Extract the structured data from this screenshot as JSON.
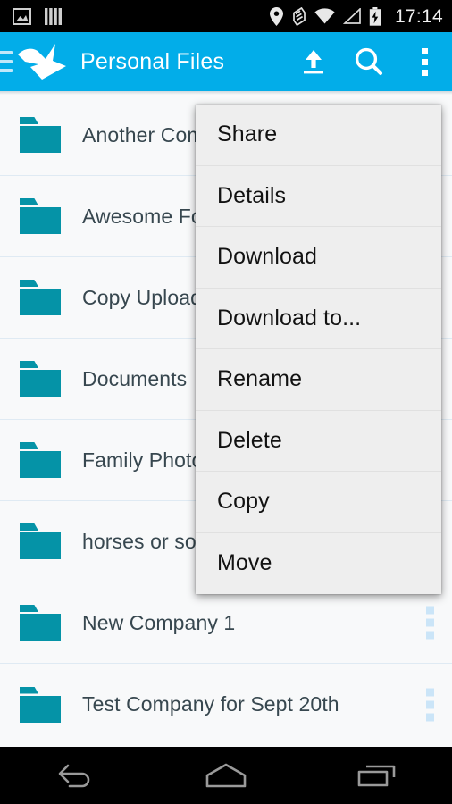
{
  "status_bar": {
    "left_icons": [
      "image-icon",
      "bars-icon"
    ],
    "right_icons": [
      "location-icon",
      "nfc-icon",
      "wifi-icon",
      "signal-icon",
      "battery-charging-icon"
    ],
    "clock": "17:14"
  },
  "app_bar": {
    "menu_icon": "hamburger-icon",
    "logo_icon": "paper-crane-logo",
    "title": "Personal Files",
    "actions": [
      {
        "name": "upload-button",
        "icon": "upload-icon"
      },
      {
        "name": "search-button",
        "icon": "search-icon"
      },
      {
        "name": "overflow-button",
        "icon": "kebab-icon"
      }
    ],
    "background_color": "#02ade9",
    "title_color": "#ffffff"
  },
  "file_list": {
    "background_color": "#f8f9fa",
    "divider_color": "#dfeaf3",
    "folder_color": "#0593a7",
    "label_color": "#37474f",
    "row_kebab_color": "#cbe5f8",
    "items": [
      {
        "name": "Another Company",
        "icon": "folder-icon"
      },
      {
        "name": "Awesome Folder",
        "icon": "folder-icon"
      },
      {
        "name": "Copy Uploads",
        "icon": "folder-icon"
      },
      {
        "name": "Documents",
        "icon": "folder-icon"
      },
      {
        "name": "Family Photos",
        "icon": "folder-icon"
      },
      {
        "name": "horses or something",
        "icon": "folder-icon"
      },
      {
        "name": "New Company 1",
        "icon": "folder-icon"
      },
      {
        "name": "Test Company for Sept 20th",
        "icon": "folder-icon"
      }
    ]
  },
  "context_menu": {
    "background_color": "#eeeeee",
    "text_color": "#121212",
    "items": [
      {
        "label": "Share"
      },
      {
        "label": "Details"
      },
      {
        "label": "Download"
      },
      {
        "label": "Download to..."
      },
      {
        "label": "Rename"
      },
      {
        "label": "Delete"
      },
      {
        "label": "Copy"
      },
      {
        "label": "Move"
      }
    ]
  },
  "nav_bar": {
    "buttons": [
      {
        "name": "back-button",
        "icon": "back-arrow-icon"
      },
      {
        "name": "home-button",
        "icon": "home-icon"
      },
      {
        "name": "recents-button",
        "icon": "recents-icon"
      }
    ]
  }
}
